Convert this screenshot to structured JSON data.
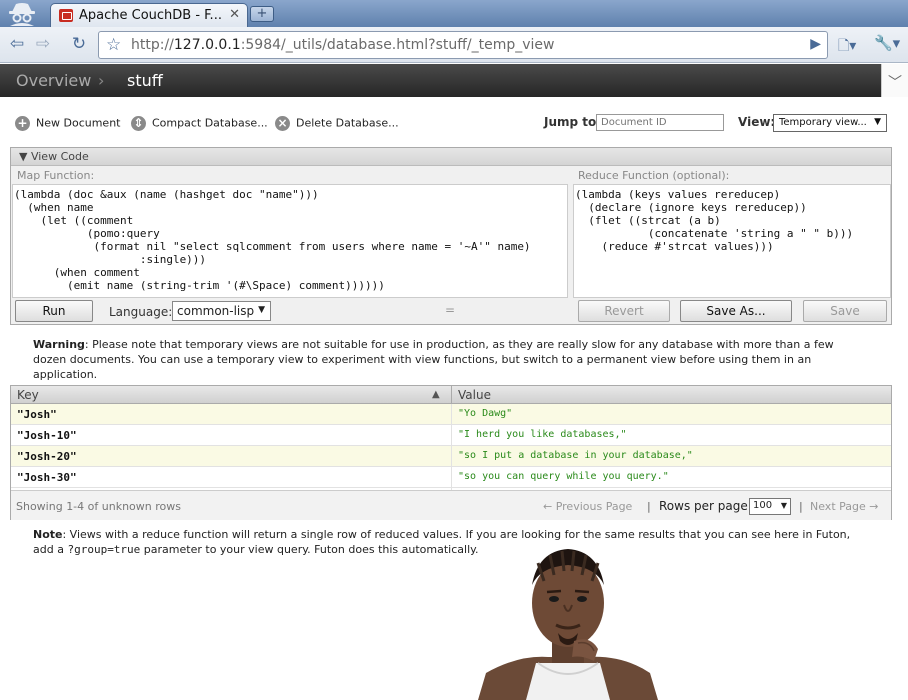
{
  "browser": {
    "tab_title": "Apache CouchDB - F...",
    "tab_close": "✕",
    "new_tab": "+",
    "url_prefix": "http://",
    "url_host": "127.0.0.1",
    "url_rest": ":5984/_utils/database.html?stuff/_temp_view"
  },
  "header": {
    "overview": "Overview",
    "separator": "›",
    "database": "stuff"
  },
  "actions": {
    "new_document": "New Document",
    "compact_database": "Compact Database...",
    "delete_database": "Delete Database...",
    "jump_to_label": "Jump to:",
    "jump_to_placeholder": "Document ID",
    "view_label": "View:",
    "view_selected": "Temporary view..."
  },
  "view_code": {
    "header": "View Code",
    "map_label": "Map Function:",
    "reduce_label": "Reduce Function (optional):",
    "map_code": "(lambda (doc &aux (name (hashget doc \"name\")))\n  (when name\n    (let ((comment\n           (pomo:query\n            (format nil \"select sqlcomment from users where name = '~A'\" name)\n                   :single)))\n      (when comment\n        (emit name (string-trim '(#\\Space) comment))))))",
    "reduce_code": "(lambda (keys values rereducep)\n  (declare (ignore keys rereducep))\n  (flet ((strcat (a b)\n           (concatenate 'string a \" \" b)))\n    (reduce #'strcat values)))",
    "run_button": "Run",
    "language_label": "Language:",
    "language_selected": "common-lisp",
    "grip": "=",
    "revert_button": "Revert",
    "save_as_button": "Save As...",
    "save_button": "Save"
  },
  "warning": {
    "bold": "Warning",
    "text": ": Please note that temporary views are not suitable for use in production, as they are really slow for any database with more than a few dozen documents. You can use a temporary view to experiment with view functions, but switch to a permanent view before using them in an application."
  },
  "results": {
    "key_header": "Key",
    "value_header": "Value",
    "rows": [
      {
        "key": "\"Josh\"",
        "value": "\"Yo Dawg\""
      },
      {
        "key": "\"Josh-10\"",
        "value": "\"I herd you like databases,\""
      },
      {
        "key": "\"Josh-20\"",
        "value": "\"so I put a database in your database,\""
      },
      {
        "key": "\"Josh-30\"",
        "value": "\"so you can query while you query.\""
      }
    ],
    "showing": "Showing 1-4 of unknown rows",
    "previous_page": "← Previous Page",
    "pipe": "|",
    "rows_per_page_label": "Rows per page:",
    "rows_per_page": "100",
    "next_page": "Next Page →"
  },
  "note": {
    "bold": "Note",
    "text_before": ": Views with a reduce function will return a single row of reduced values. If you are looking for the same results that you can see here in Futon, add a ",
    "code": "?group=true",
    "text_after": " parameter to your view query. Futon does this automatically."
  },
  "icons": {
    "back": "back-arrow-icon",
    "forward": "forward-arrow-icon",
    "reload": "reload-icon",
    "star": "star-icon",
    "go": "play-icon",
    "page_menu": "page-menu-icon",
    "wrench": "wrench-icon"
  }
}
